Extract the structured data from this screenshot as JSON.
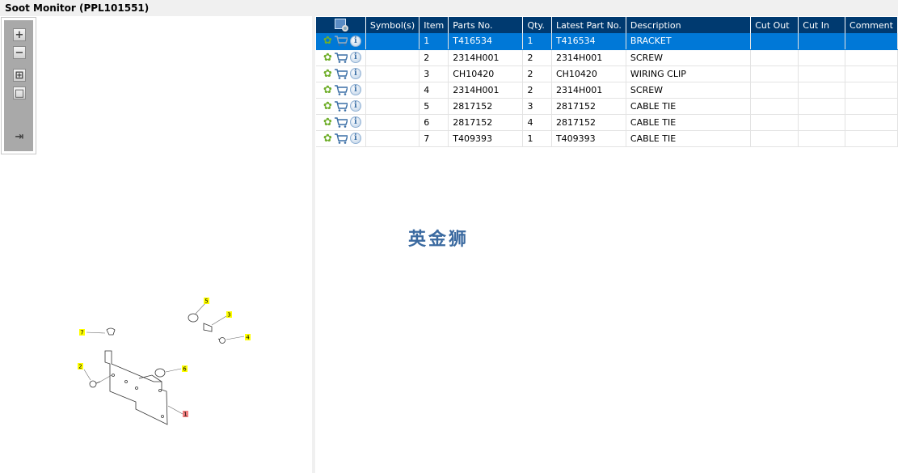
{
  "window": {
    "title": "Soot Monitor (PPL101551)"
  },
  "toolbar": {
    "buttons": [
      {
        "name": "zoom-in",
        "glyph": "+"
      },
      {
        "name": "zoom-out",
        "glyph": "−"
      },
      {
        "name": "fit-all",
        "glyph": "⊞"
      },
      {
        "name": "actual-size",
        "glyph": "□"
      },
      {
        "name": "export",
        "glyph": "⇥"
      }
    ]
  },
  "diagram": {
    "callouts": [
      "1",
      "2",
      "3",
      "4",
      "5",
      "6",
      "7"
    ]
  },
  "table": {
    "headers": [
      "",
      "Symbol(s)",
      "Item",
      "Parts No.",
      "Qty.",
      "Latest Part No.",
      "Description",
      "Cut Out",
      "Cut In",
      "Comment"
    ],
    "selected_row": 0,
    "rows": [
      {
        "symbol": "",
        "item": "1",
        "parts_no": "T416534",
        "qty": "1",
        "latest": "T416534",
        "desc": "BRACKET",
        "cut_out": "",
        "cut_in": "",
        "comment": ""
      },
      {
        "symbol": "",
        "item": "2",
        "parts_no": "2314H001",
        "qty": "2",
        "latest": "2314H001",
        "desc": "SCREW",
        "cut_out": "",
        "cut_in": "",
        "comment": ""
      },
      {
        "symbol": "",
        "item": "3",
        "parts_no": "CH10420",
        "qty": "2",
        "latest": "CH10420",
        "desc": "WIRING CLIP",
        "cut_out": "",
        "cut_in": "",
        "comment": ""
      },
      {
        "symbol": "",
        "item": "4",
        "parts_no": "2314H001",
        "qty": "2",
        "latest": "2314H001",
        "desc": "SCREW",
        "cut_out": "",
        "cut_in": "",
        "comment": ""
      },
      {
        "symbol": "",
        "item": "5",
        "parts_no": "2817152",
        "qty": "3",
        "latest": "2817152",
        "desc": "CABLE TIE",
        "cut_out": "",
        "cut_in": "",
        "comment": ""
      },
      {
        "symbol": "",
        "item": "6",
        "parts_no": "2817152",
        "qty": "4",
        "latest": "2817152",
        "desc": "CABLE TIE",
        "cut_out": "",
        "cut_in": "",
        "comment": ""
      },
      {
        "symbol": "",
        "item": "7",
        "parts_no": "T409393",
        "qty": "1",
        "latest": "T409393",
        "desc": "CABLE TIE",
        "cut_out": "",
        "cut_in": "",
        "comment": ""
      }
    ]
  },
  "watermark": "英金狮",
  "colors": {
    "header": "#003a70",
    "selected": "#0078d7",
    "callout": "#ffff00",
    "callout_main": "#f08080"
  }
}
